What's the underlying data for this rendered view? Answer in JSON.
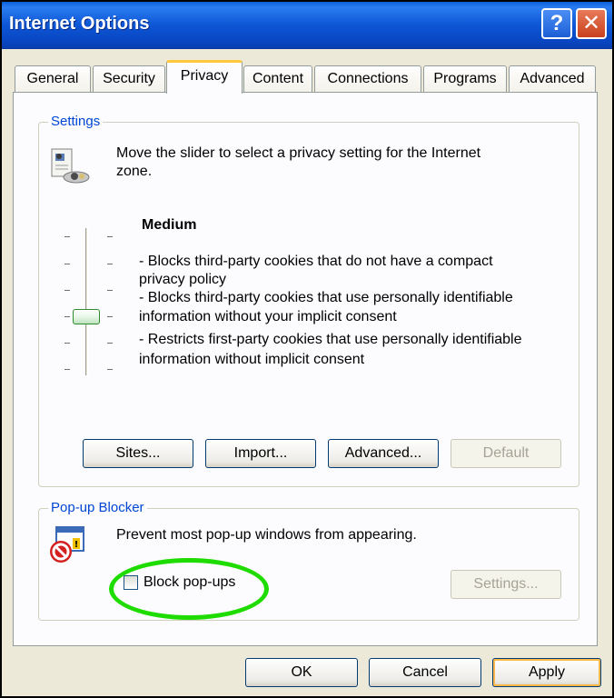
{
  "window": {
    "title": "Internet Options",
    "help_glyph": "?",
    "close_glyph": "✕"
  },
  "tabs": [
    {
      "label": "General",
      "active": false
    },
    {
      "label": "Security",
      "active": false
    },
    {
      "label": "Privacy",
      "active": true
    },
    {
      "label": "Content",
      "active": false
    },
    {
      "label": "Connections",
      "active": false
    },
    {
      "label": "Programs",
      "active": false
    },
    {
      "label": "Advanced",
      "active": false
    }
  ],
  "settings": {
    "group_label": "Settings",
    "description_line1": "Move the slider to select a privacy setting for the Internet",
    "description_line2": "zone.",
    "level_title": "Medium",
    "level_lines": [
      "- Blocks third-party cookies that do not have a compact",
      "privacy policy",
      "- Blocks third-party cookies that use personally identifiable",
      "information without your implicit consent",
      "- Restricts first-party cookies that use personally identifiable",
      "information without implicit consent"
    ],
    "slider_level": 3,
    "slider_levels_total": 6,
    "buttons": {
      "sites": "Sites...",
      "import": "Import...",
      "advanced": "Advanced...",
      "default": "Default"
    }
  },
  "popup_blocker": {
    "group_label": "Pop-up Blocker",
    "description": "Prevent most pop-up windows from appearing.",
    "checkbox_label": "Block pop-ups",
    "checked": false,
    "settings_button": "Settings..."
  },
  "footer": {
    "ok": "OK",
    "cancel": "Cancel",
    "apply": "Apply"
  },
  "colors": {
    "titlebar": "#0a56d6",
    "group_label": "#0046d5",
    "active_tab_accent": "#ffc83c",
    "highlight": "#1edc00"
  },
  "icons": [
    "help-icon",
    "close-icon",
    "privacy-icon",
    "popup-blocker-icon"
  ]
}
